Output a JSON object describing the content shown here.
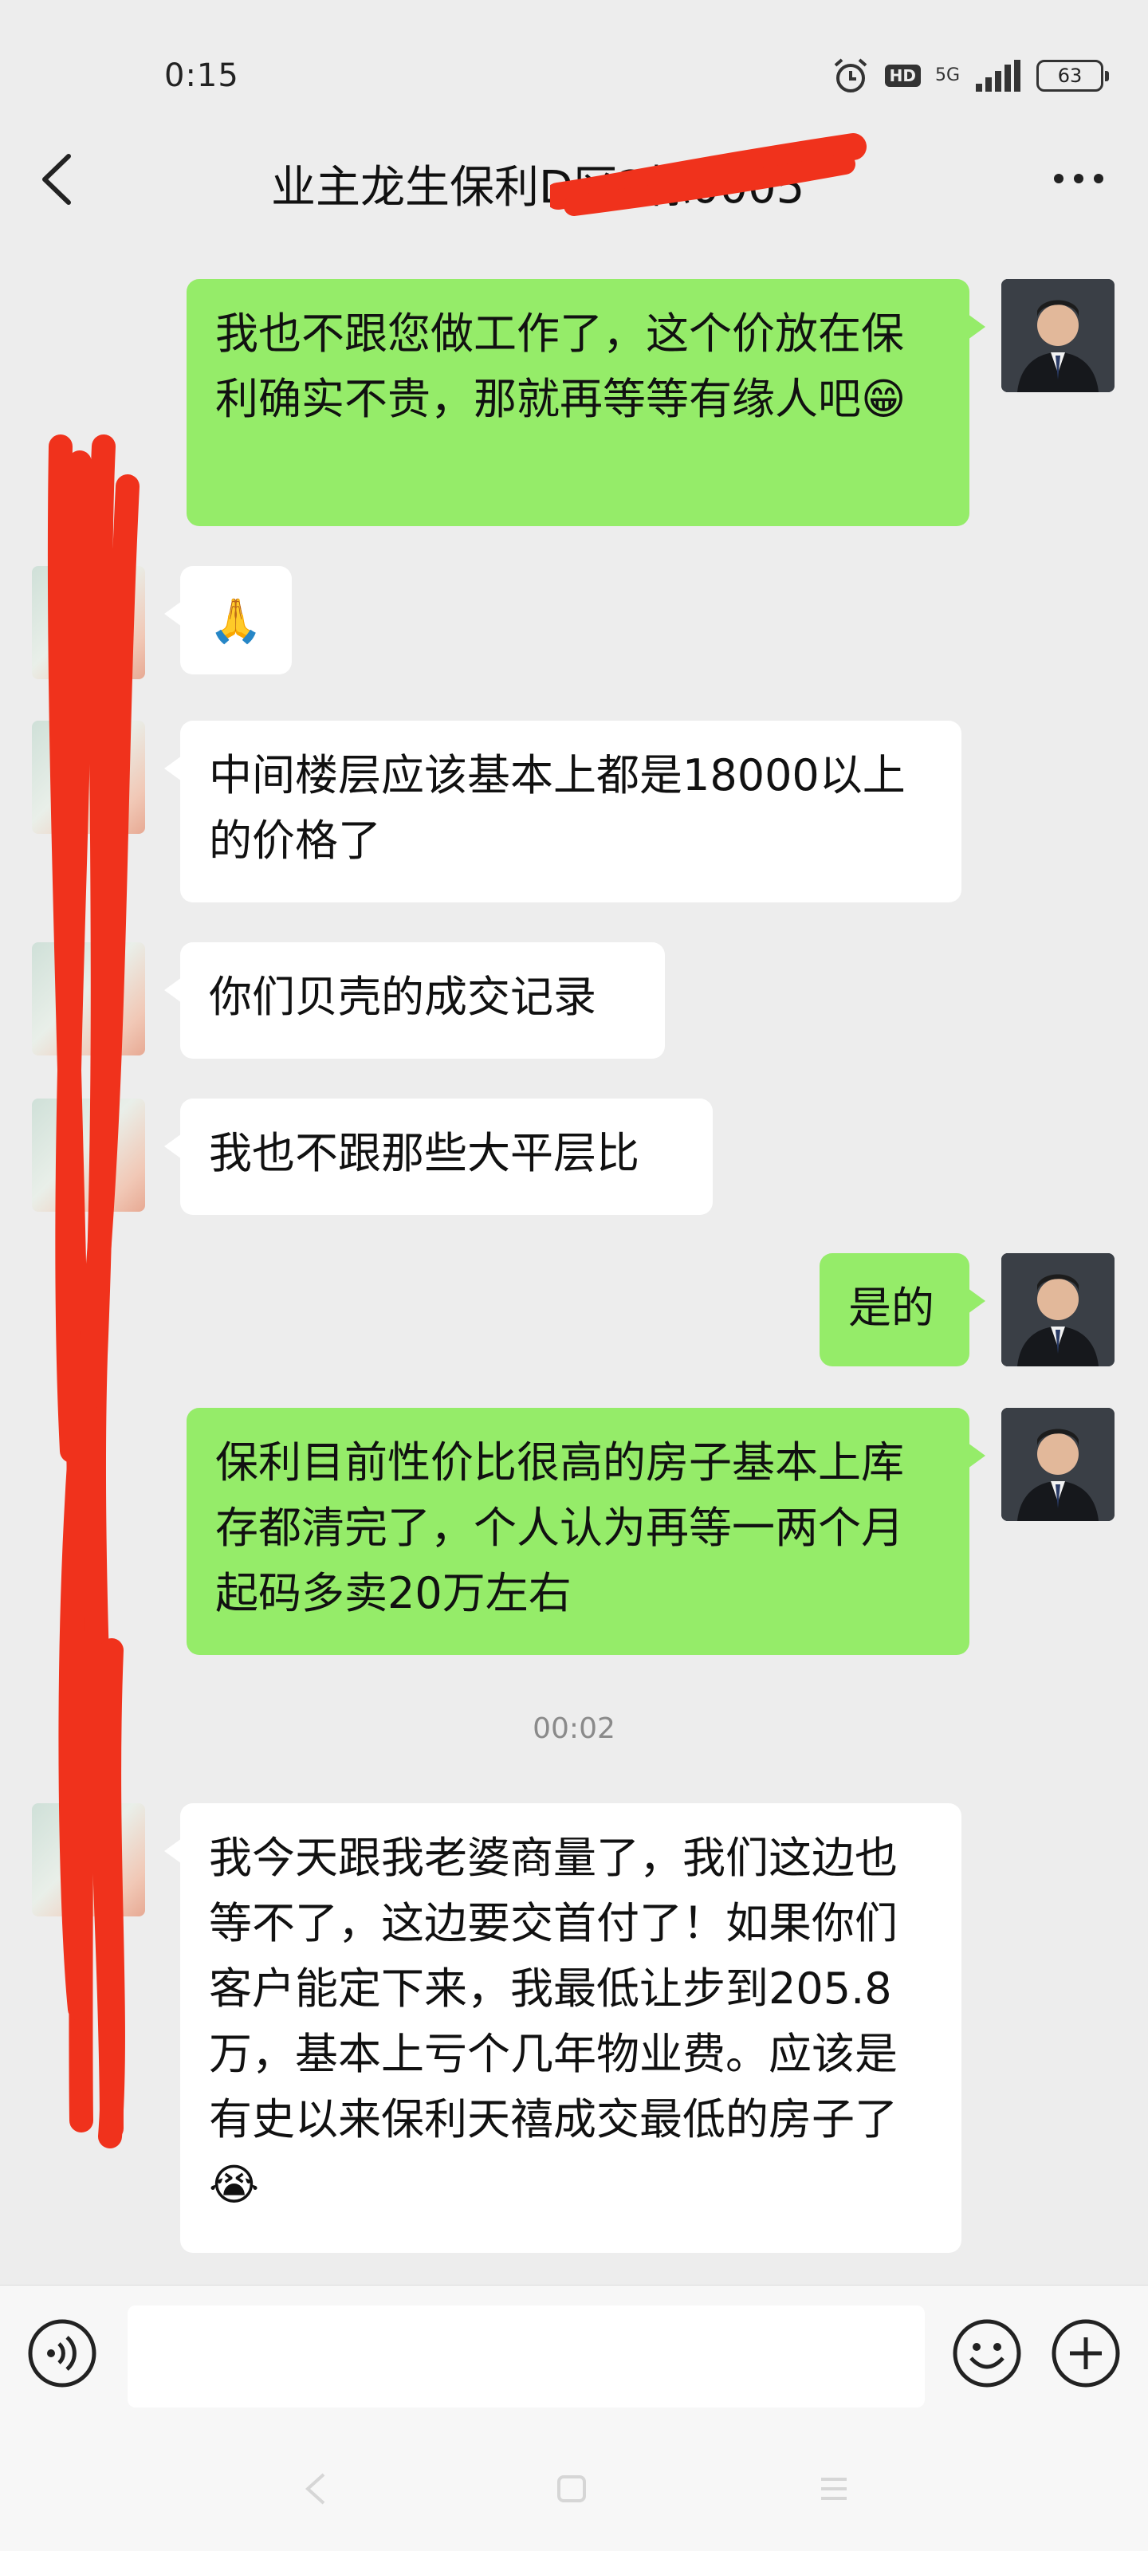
{
  "status_bar": {
    "time": "0:15",
    "hd_label": "HD",
    "network": "5G",
    "battery": "63"
  },
  "header": {
    "title": "业主龙生保利D区2栋0005",
    "back_icon": "chevron-left-icon",
    "more_icon": "ellipsis-icon"
  },
  "messages": [
    {
      "side": "self",
      "text": "我也不跟您做工作了，这个价放在保利确实不贵，那就再等等有缘人吧😁"
    },
    {
      "side": "other",
      "text": "🙏"
    },
    {
      "side": "other",
      "text": "中间楼层应该基本上都是18000以上的价格了"
    },
    {
      "side": "other",
      "text": "你们贝壳的成交记录"
    },
    {
      "side": "other",
      "text": "我也不跟那些大平层比"
    },
    {
      "side": "self",
      "text": "是的"
    },
    {
      "side": "self",
      "text": "保利目前性价比很高的房子基本上库存都清完了，个人认为再等一两个月起码多卖20万左右"
    },
    {
      "side": "other",
      "text": "我今天跟我老婆商量了，我们这边也等不了，这边要交首付了！如果你们客户能定下来，我最低让步到205.8万，基本上亏个几年物业费。应该是有史以来保利天禧成交最低的房子了😭"
    }
  ],
  "timestamp": "00:02",
  "input_bar": {
    "voice_icon": "voice-icon",
    "emoji_icon": "emoji-icon",
    "plus_icon": "plus-icon",
    "value": ""
  },
  "system_nav": {
    "back": "back-triangle-icon",
    "home": "home-square-icon",
    "menu": "menu-lines-icon"
  },
  "colors": {
    "background": "#ededed",
    "self_bubble": "#95ec69",
    "other_bubble": "#ffffff",
    "redaction": "#f0321c"
  }
}
